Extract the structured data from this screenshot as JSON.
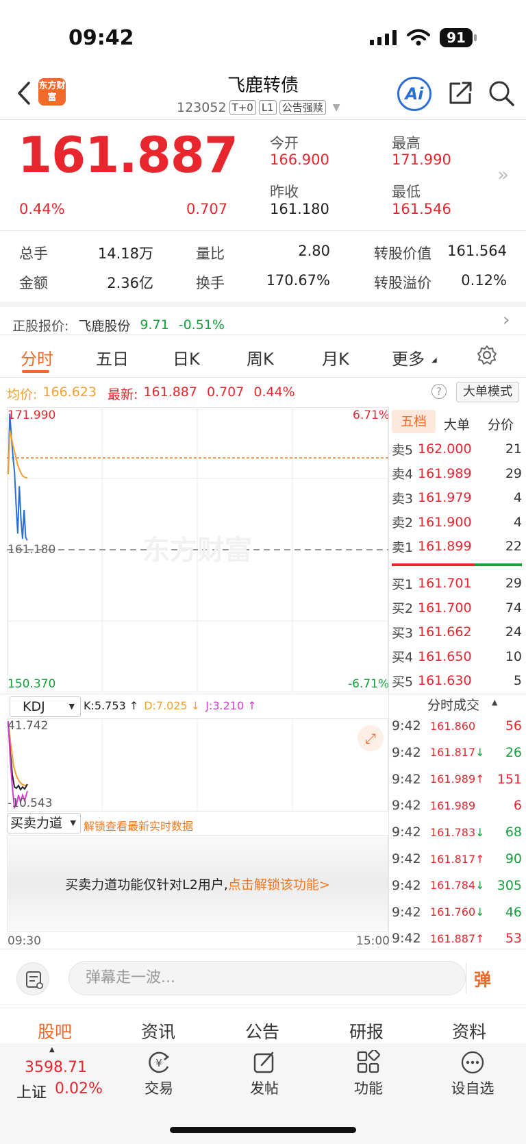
{
  "status_bar": {
    "time": "09:42",
    "battery": "91"
  },
  "header": {
    "title": "飞鹿转债",
    "code": "123052",
    "tags": [
      "T+0",
      "L1",
      "公告强赎"
    ],
    "logo_text": "东方财富",
    "ai_label": "Ai"
  },
  "quote": {
    "price": "161.887",
    "change_pct": "0.44%",
    "change_amt": "0.707",
    "open_label": "今开",
    "open": "166.900",
    "high_label": "最高",
    "high": "171.990",
    "prev_label": "昨收",
    "prev": "161.180",
    "low_label": "最低",
    "low": "161.546"
  },
  "stats": [
    [
      {
        "label": "总手",
        "value": "14.18万"
      },
      {
        "label": "量比",
        "value": "2.80"
      },
      {
        "label": "转股价值",
        "value": "161.564",
        "red": false
      }
    ],
    [
      {
        "label": "金额",
        "value": "2.36亿"
      },
      {
        "label": "换手",
        "value": "170.67%"
      },
      {
        "label": "转股溢价",
        "value": "0.12%",
        "red": true
      }
    ]
  ],
  "underlying": {
    "label": "正股报价:",
    "name": "飞鹿股份",
    "price": "9.71",
    "change": "-0.51%"
  },
  "tabs": [
    "分时",
    "五日",
    "日K",
    "周K",
    "月K",
    "更多"
  ],
  "chart_header": {
    "avg_label": "均价:",
    "avg": "166.623",
    "latest_label": "最新:",
    "latest": "161.887",
    "latest_chg": "0.707",
    "latest_pct": "0.44%",
    "mode_button": "大单模式"
  },
  "chart_labels": {
    "y_top": "171.990",
    "y_top_pct": "6.71%",
    "y_mid": "161.180",
    "y_bottom": "150.370",
    "y_bottom_pct": "-6.71%",
    "x_start": "09:30",
    "x_end": "15:00",
    "watermark": "东方财富"
  },
  "chart_data": {
    "type": "line",
    "title": "",
    "xlabel": "",
    "ylabel": "",
    "ylim": [
      150.37,
      171.99
    ],
    "x": [
      "09:30",
      "09:31",
      "09:32",
      "09:33",
      "09:34",
      "09:35",
      "09:36",
      "09:37",
      "09:38",
      "09:39",
      "09:40",
      "09:41",
      "09:42"
    ],
    "series": [
      {
        "name": "price",
        "values": [
          166.9,
          171.5,
          169.8,
          168.2,
          167.0,
          164.5,
          162.4,
          166.0,
          163.5,
          162.0,
          164.2,
          162.1,
          161.887
        ]
      },
      {
        "name": "avg",
        "values": [
          166.9,
          170.2,
          169.7,
          169.1,
          168.6,
          168.1,
          167.6,
          167.3,
          167.0,
          166.8,
          166.7,
          166.65,
          166.623
        ]
      }
    ]
  },
  "book_tabs": [
    "五档",
    "大单",
    "分价"
  ],
  "asks": [
    {
      "label": "卖5",
      "price": "162.000",
      "vol": "21"
    },
    {
      "label": "卖4",
      "price": "161.989",
      "vol": "29"
    },
    {
      "label": "卖3",
      "price": "161.979",
      "vol": "4"
    },
    {
      "label": "卖2",
      "price": "161.900",
      "vol": "4"
    },
    {
      "label": "卖1",
      "price": "161.899",
      "vol": "22"
    }
  ],
  "bids": [
    {
      "label": "买1",
      "price": "161.701",
      "vol": "29"
    },
    {
      "label": "买2",
      "price": "161.700",
      "vol": "74"
    },
    {
      "label": "买3",
      "price": "161.662",
      "vol": "24"
    },
    {
      "label": "买4",
      "price": "161.650",
      "vol": "10"
    },
    {
      "label": "买5",
      "price": "161.630",
      "vol": "5"
    }
  ],
  "kdj": {
    "selector": "KDJ",
    "k": "K:5.753 ↑",
    "d": "D:7.025 ↓",
    "j": "J:3.210 ↑",
    "top": "41.742",
    "bottom": "-10.543"
  },
  "trades_header": "分时成交",
  "trades": [
    {
      "time": "9:42",
      "price": "161.860",
      "arrow": "",
      "vol": "56",
      "color": "red"
    },
    {
      "time": "9:42",
      "price": "161.817",
      "arrow": "↓",
      "vol": "26",
      "color": "green"
    },
    {
      "time": "9:42",
      "price": "161.989",
      "arrow": "↑",
      "vol": "151",
      "color": "red"
    },
    {
      "time": "9:42",
      "price": "161.989",
      "arrow": "",
      "vol": "6",
      "color": "red"
    },
    {
      "time": "9:42",
      "price": "161.783",
      "arrow": "↓",
      "vol": "68",
      "color": "green"
    },
    {
      "time": "9:42",
      "price": "161.817",
      "arrow": "↑",
      "vol": "90",
      "color": "green"
    },
    {
      "time": "9:42",
      "price": "161.784",
      "arrow": "↓",
      "vol": "305",
      "color": "green"
    },
    {
      "time": "9:42",
      "price": "161.760",
      "arrow": "↓",
      "vol": "46",
      "color": "green"
    },
    {
      "time": "9:42",
      "price": "161.887",
      "arrow": "↑",
      "vol": "53",
      "color": "red"
    }
  ],
  "power": {
    "selector": "买卖力道",
    "unlock_hint": "解锁查看最新实时数据",
    "locked_msg": "买卖力道功能仅针对L2用户,",
    "unlock_link": "点击解锁该功能>"
  },
  "comment": {
    "placeholder": "弹幕走一波...",
    "danmu": "弹"
  },
  "sub_nav": [
    "股吧",
    "资讯",
    "公告",
    "研报",
    "资料"
  ],
  "index_quote": {
    "value": "3598.71",
    "name": "上证",
    "pct": "0.02%"
  },
  "bottom_nav": [
    "交易",
    "发帖",
    "功能",
    "设自选"
  ],
  "colors": {
    "accent": "#f26a2a",
    "up": "#e8262e",
    "down": "#16a03c",
    "avg_line": "#f0a030",
    "price_line": "#2b6fd6"
  }
}
